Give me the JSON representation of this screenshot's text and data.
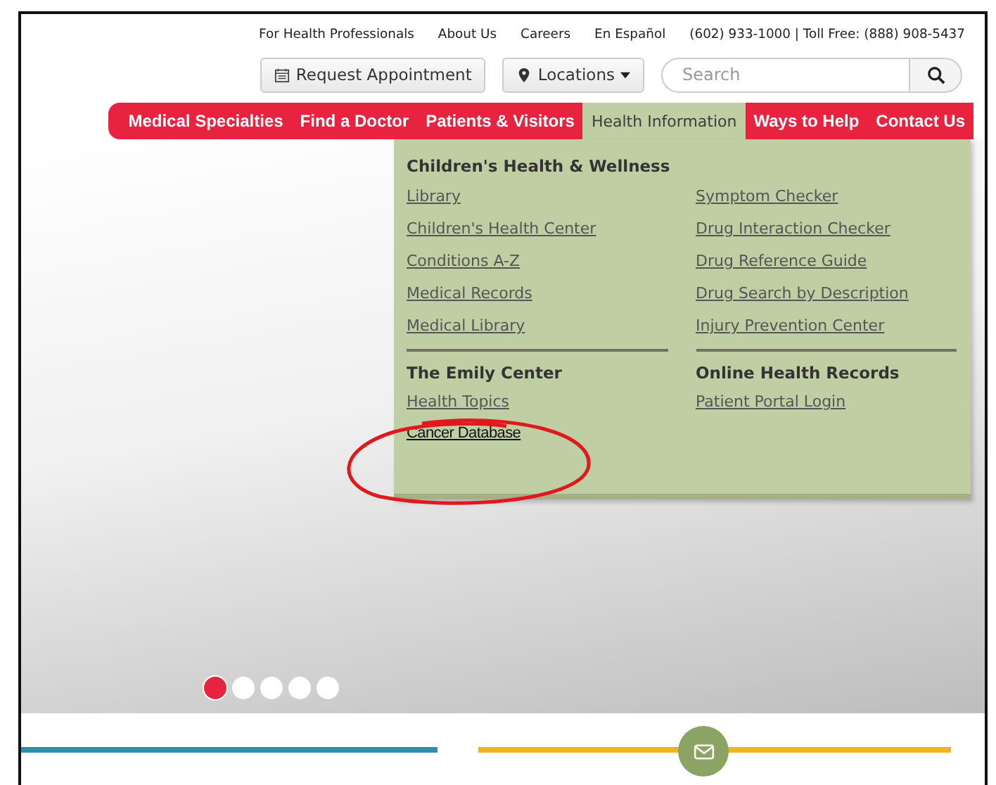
{
  "top_links": [
    "For Health Professionals",
    "About Us",
    "Careers",
    "En Español"
  ],
  "phone": "(602) 933-1000 | Toll Free: (888) 908-5437",
  "request_button": "Request Appointment",
  "locations_button": "Locations",
  "search": {
    "placeholder": "Search"
  },
  "nav": [
    {
      "label": "Medical Specialties",
      "selected": false
    },
    {
      "label": "Find a Doctor",
      "selected": false
    },
    {
      "label": "Patients & Visitors",
      "selected": false
    },
    {
      "label": "Health Information",
      "selected": true
    },
    {
      "label": "Ways to Help",
      "selected": false
    },
    {
      "label": "Contact Us",
      "selected": false
    }
  ],
  "menu": {
    "sections": [
      {
        "heading": "Children's Health & Wellness",
        "columns": [
          [
            {
              "label": "Library",
              "kind": "link"
            },
            {
              "label": "Children's Health Center",
              "kind": "link"
            },
            {
              "label": "Conditions A-Z",
              "kind": "link"
            },
            {
              "label": "Medical Records",
              "kind": "link"
            },
            {
              "label": "Medical Library",
              "kind": "link"
            }
          ],
          [
            {
              "label": "Symptom Checker",
              "kind": "link"
            },
            {
              "label": "Drug Interaction Checker",
              "kind": "link"
            },
            {
              "label": "Drug Reference Guide",
              "kind": "link"
            },
            {
              "label": "Drug Search by Description",
              "kind": "link"
            },
            {
              "label": "Injury Prevention Center",
              "kind": "link"
            }
          ]
        ]
      }
    ],
    "lower": [
      {
        "heading": "The Emily Center",
        "links": [
          {
            "label": "Health Topics",
            "kind": "link"
          },
          {
            "label": "Cancer Database",
            "kind": "plain"
          }
        ]
      },
      {
        "heading": "Online Health Records",
        "links": [
          {
            "label": "Patient Portal Login",
            "kind": "link"
          }
        ]
      }
    ]
  },
  "slides": [
    {
      "selected": true
    },
    {
      "selected": false
    },
    {
      "selected": false
    },
    {
      "selected": false
    },
    {
      "selected": false
    }
  ]
}
